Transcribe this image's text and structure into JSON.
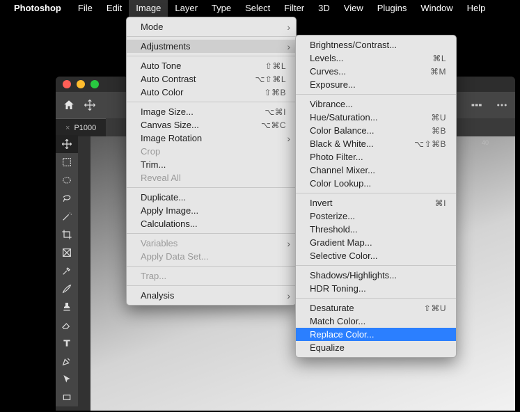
{
  "menubar": {
    "app": "Photoshop",
    "items": [
      "File",
      "Edit",
      "Image",
      "Layer",
      "Type",
      "Select",
      "Filter",
      "3D",
      "View",
      "Plugins",
      "Window",
      "Help"
    ],
    "open_index": 2
  },
  "document": {
    "tab_label": "P1000"
  },
  "ruler": {
    "tick_40": "40"
  },
  "image_menu": {
    "mode": "Mode",
    "adjustments": "Adjustments",
    "auto_tone": {
      "label": "Auto Tone",
      "shortcut": "⇧⌘L"
    },
    "auto_contrast": {
      "label": "Auto Contrast",
      "shortcut": "⌥⇧⌘L"
    },
    "auto_color": {
      "label": "Auto Color",
      "shortcut": "⇧⌘B"
    },
    "image_size": {
      "label": "Image Size...",
      "shortcut": "⌥⌘I"
    },
    "canvas_size": {
      "label": "Canvas Size...",
      "shortcut": "⌥⌘C"
    },
    "image_rotation": "Image Rotation",
    "crop": "Crop",
    "trim": "Trim...",
    "reveal_all": "Reveal All",
    "duplicate": "Duplicate...",
    "apply_image": "Apply Image...",
    "calculations": "Calculations...",
    "variables": "Variables",
    "apply_data_set": "Apply Data Set...",
    "trap": "Trap...",
    "analysis": "Analysis"
  },
  "adjust_menu": {
    "brightness": "Brightness/Contrast...",
    "levels": {
      "label": "Levels...",
      "shortcut": "⌘L"
    },
    "curves": {
      "label": "Curves...",
      "shortcut": "⌘M"
    },
    "exposure": "Exposure...",
    "vibrance": "Vibrance...",
    "hue": {
      "label": "Hue/Saturation...",
      "shortcut": "⌘U"
    },
    "color_balance": {
      "label": "Color Balance...",
      "shortcut": "⌘B"
    },
    "bw": {
      "label": "Black & White...",
      "shortcut": "⌥⇧⌘B"
    },
    "photo_filter": "Photo Filter...",
    "channel_mixer": "Channel Mixer...",
    "color_lookup": "Color Lookup...",
    "invert": {
      "label": "Invert",
      "shortcut": "⌘I"
    },
    "posterize": "Posterize...",
    "threshold": "Threshold...",
    "gradient_map": "Gradient Map...",
    "selective": "Selective Color...",
    "shadows": "Shadows/Highlights...",
    "hdr": "HDR Toning...",
    "desaturate": {
      "label": "Desaturate",
      "shortcut": "⇧⌘U"
    },
    "match_color": "Match Color...",
    "replace_color": "Replace Color...",
    "equalize": "Equalize"
  },
  "tools": [
    "move",
    "artboard",
    "marquee",
    "lasso",
    "wand",
    "crop",
    "frame",
    "eyedropper",
    "brush",
    "stamp",
    "eraser",
    "type",
    "pen",
    "path-select",
    "hand",
    "rectangle"
  ]
}
